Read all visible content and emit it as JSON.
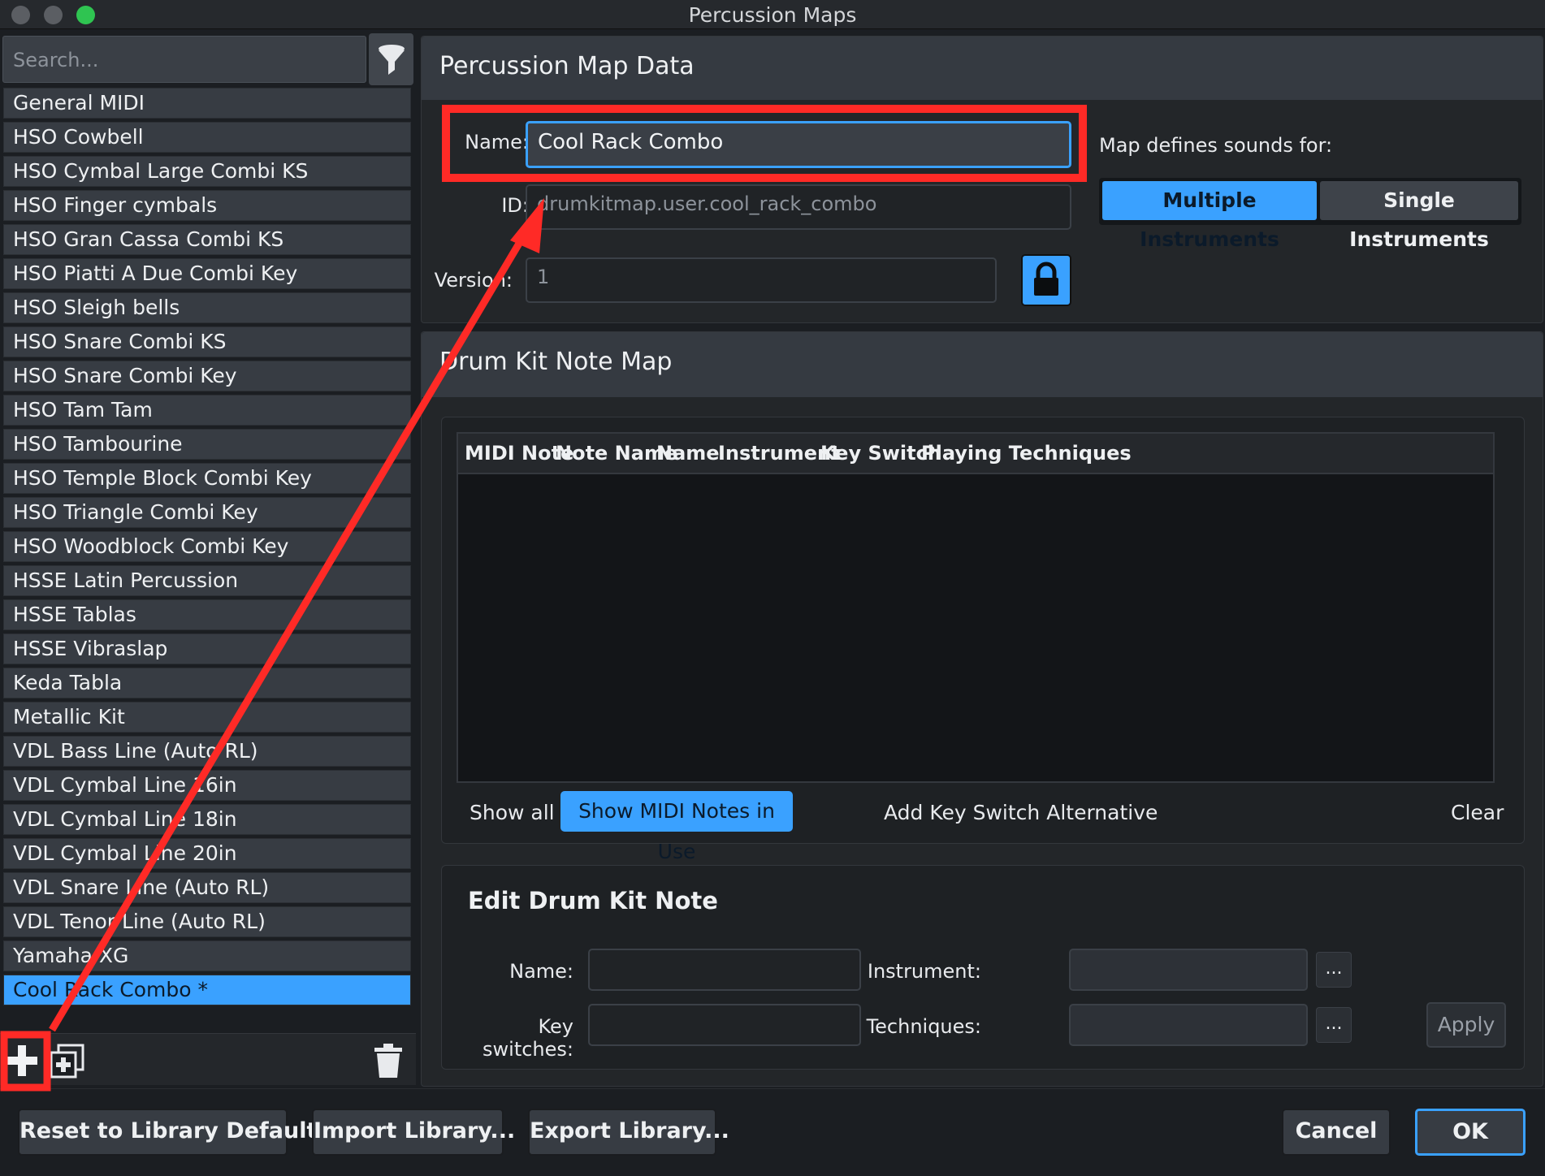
{
  "window": {
    "title": "Percussion Maps"
  },
  "sidebar": {
    "search_placeholder": "Search...",
    "items": [
      "General MIDI",
      "HSO Cowbell",
      "HSO Cymbal Large Combi KS",
      "HSO Finger cymbals",
      "HSO Gran Cassa Combi KS",
      "HSO Piatti A Due Combi Key",
      "HSO Sleigh bells",
      "HSO Snare Combi KS",
      "HSO Snare Combi Key",
      "HSO Tam Tam",
      "HSO Tambourine",
      "HSO Temple Block Combi Key",
      "HSO Triangle Combi Key",
      "HSO Woodblock Combi Key",
      "HSSE Latin Percussion",
      "HSSE Tablas",
      "HSSE Vibraslap",
      "Keda Tabla",
      "Metallic Kit",
      "VDL Bass Line (Auto RL)",
      "VDL Cymbal Line 16in",
      "VDL Cymbal Line 18in",
      "VDL Cymbal Line 20in",
      "VDL Snare Line (Auto RL)",
      "VDL Tenor Line (Auto RL)",
      "Yamaha XG",
      "Cool Rack Combo *"
    ],
    "selected_index": 26
  },
  "map_data": {
    "header": "Percussion Map Data",
    "name_label": "Name:",
    "name_value": "Cool Rack Combo",
    "id_label": "ID:",
    "id_value": "drumkitmap.user.cool_rack_combo",
    "version_label": "Version:",
    "version_value": "1",
    "defines_label": "Map defines sounds for:",
    "multiple_label": "Multiple Instruments",
    "single_label": "Single Instruments"
  },
  "note_map": {
    "header": "Drum Kit Note Map",
    "columns": [
      "MIDI Note",
      "Note Name",
      "Name",
      "Instrument",
      "Key Switch",
      "Playing Techniques"
    ],
    "show_all": "Show all",
    "show_in_use": "Show MIDI Notes in Use",
    "add_key_switch": "Add Key Switch Alternative",
    "clear": "Clear"
  },
  "edit_note": {
    "title": "Edit Drum Kit Note",
    "name_label": "Name:",
    "instrument_label": "Instrument:",
    "key_switches_label": "Key switches:",
    "techniques_label": "Techniques:",
    "dots": "...",
    "apply": "Apply"
  },
  "footer": {
    "reset": "Reset to Library Defaults",
    "import": "Import Library...",
    "export": "Export Library...",
    "cancel": "Cancel",
    "ok": "OK"
  },
  "colors": {
    "accent": "#3aa1ff",
    "annotation": "#ff2a26"
  }
}
